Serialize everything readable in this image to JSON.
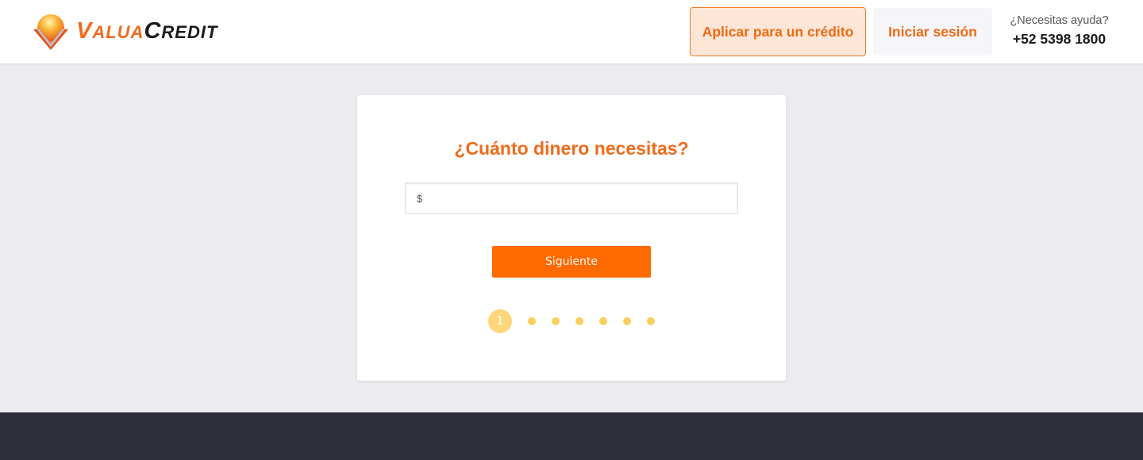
{
  "header": {
    "logo": {
      "part1": "Valua",
      "part2": "Credit",
      "icon": "valuacredit-logo-icon"
    },
    "apply_label": "Aplicar para un crédito",
    "login_label": "Iniciar sesión",
    "help_label": "¿Necesitas ayuda?",
    "phone": "+52 5398 1800"
  },
  "form": {
    "title": "¿Cuánto dinero necesitas?",
    "amount_prefix": "$",
    "amount_value": "",
    "next_label": "Siguiente"
  },
  "stepper": {
    "current_step": "1",
    "total_steps": 7
  },
  "colors": {
    "brand_orange": "#ff6a00",
    "step_yellow": "#fcce5c",
    "footer_dark": "#2e2d3a",
    "background": "#ecebf0"
  }
}
